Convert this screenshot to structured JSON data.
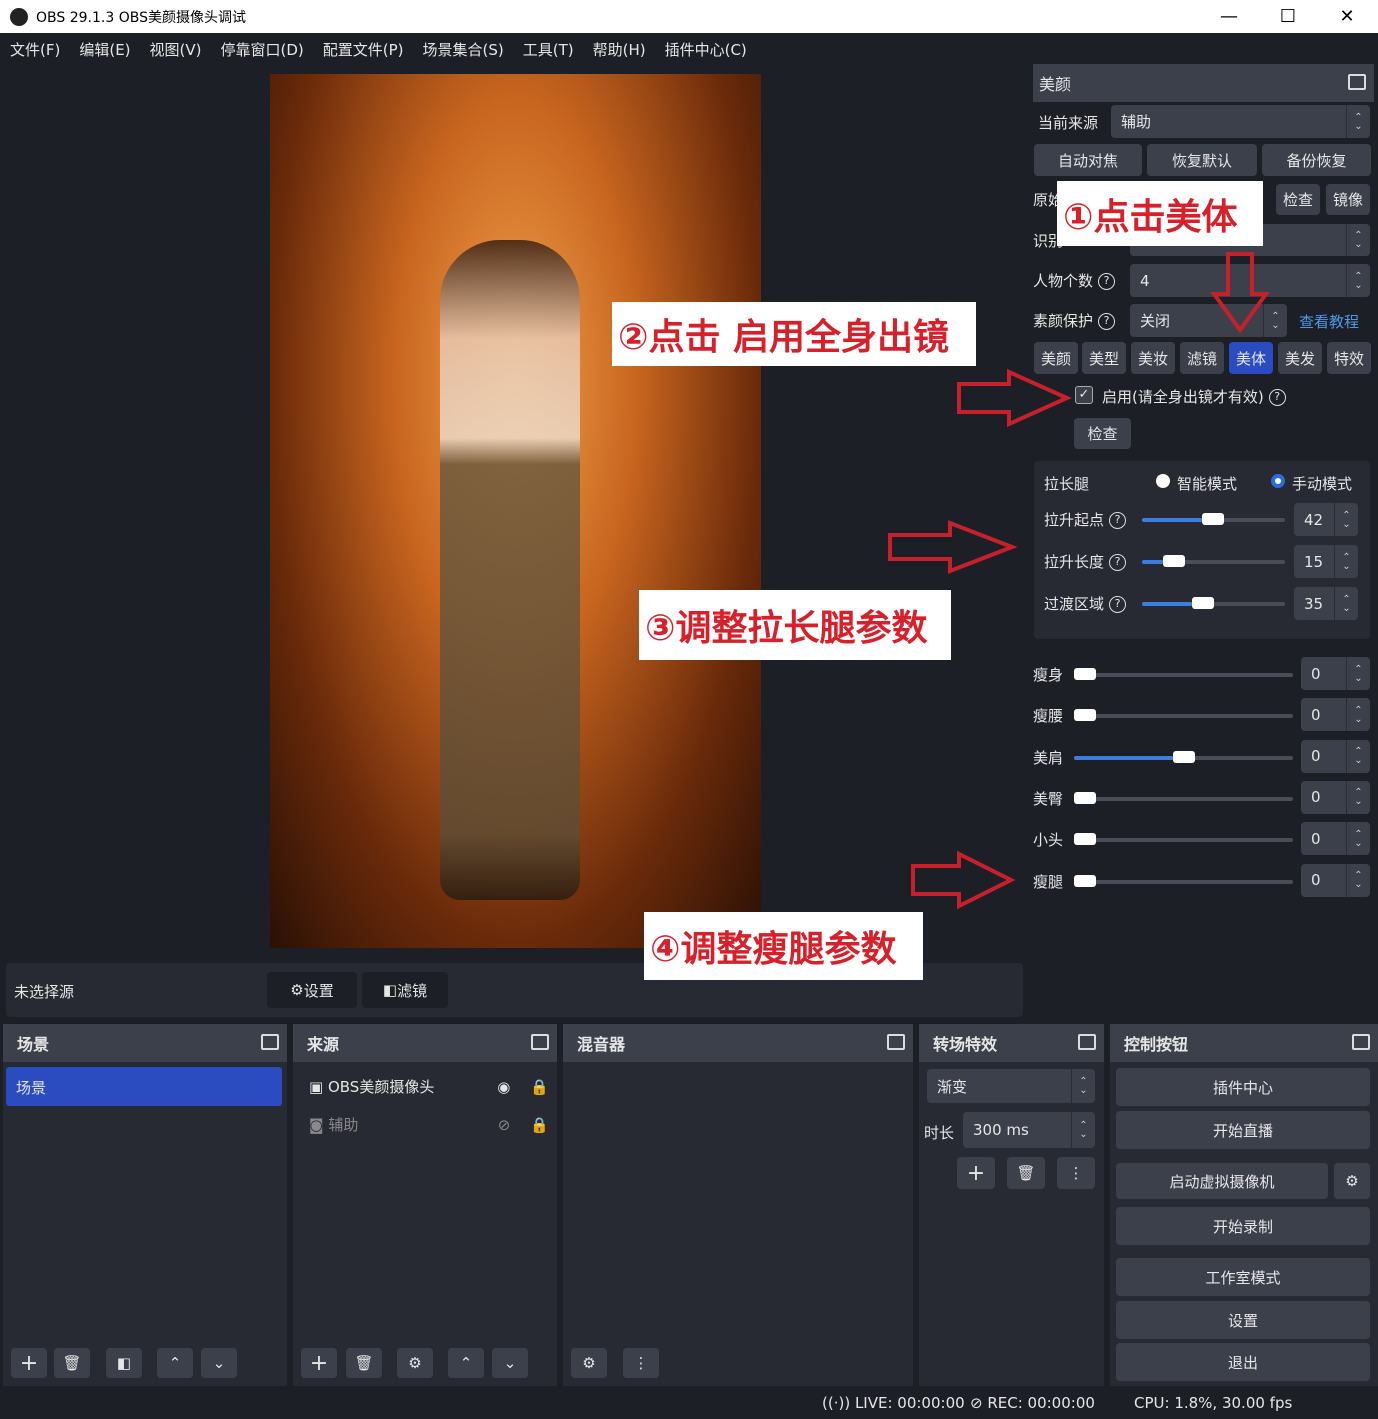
{
  "titlebar": {
    "title": "OBS 29.1.3  OBS美颜摄像头调试",
    "minimize": "—",
    "maximize": "☐",
    "close": "✕"
  },
  "menu": [
    "文件(F)",
    "编辑(E)",
    "视图(V)",
    "停靠窗口(D)",
    "配置文件(P)",
    "场景集合(S)",
    "工具(T)",
    "帮助(H)",
    "插件中心(C)"
  ],
  "beauty": {
    "title": "美颜",
    "current_source_label": "当前来源",
    "current_source": "辅助",
    "buttons": [
      "自动对焦",
      "恢复默认",
      "备份恢复"
    ],
    "original_label": "原始",
    "check": "检查",
    "mirror": "镜像",
    "recog_label": "识别",
    "person_count_label": "人物个数",
    "person_count": "4",
    "protect_label": "素颜保护",
    "protect_value": "关闭",
    "tutorial": "查看教程",
    "tabs": [
      "美颜",
      "美型",
      "美妆",
      "滤镜",
      "美体",
      "美发",
      "特效"
    ],
    "active_tab": "美体",
    "enable_label": "启用(请全身出镜才有效)",
    "enable_checked": true,
    "check2": "检查",
    "leg": {
      "label": "拉长腿",
      "mode_smart": "智能模式",
      "mode_manual": "手动模式",
      "selected_mode": "手动模式",
      "params": [
        {
          "label": "拉升起点",
          "value": "42"
        },
        {
          "label": "拉升长度",
          "value": "15"
        },
        {
          "label": "过渡区域",
          "value": "35"
        }
      ]
    },
    "sliders": [
      {
        "label": "瘦身",
        "value": "0"
      },
      {
        "label": "瘦腰",
        "value": "0"
      },
      {
        "label": "美肩",
        "value": "0"
      },
      {
        "label": "美臀",
        "value": "0"
      },
      {
        "label": "小头",
        "value": "0"
      },
      {
        "label": "瘦腿",
        "value": "0"
      }
    ]
  },
  "annotations": [
    "①点击美体",
    "②点击 启用全身出镜",
    "③调整拉长腿参数",
    "④调整瘦腿参数"
  ],
  "sourcebar": {
    "no_source": "未选择源",
    "settings": "设置",
    "filters": "滤镜"
  },
  "scenes": {
    "title": "场景",
    "items": [
      "场景"
    ]
  },
  "sources": {
    "title": "来源",
    "items": [
      {
        "name": "OBS美颜摄像头",
        "visible": true
      },
      {
        "name": "辅助",
        "visible": false
      }
    ]
  },
  "mixer": {
    "title": "混音器"
  },
  "transitions": {
    "title": "转场特效",
    "type": "渐变",
    "duration_label": "时长",
    "duration": "300 ms"
  },
  "controls": {
    "title": "控制按钮",
    "buttons": [
      "插件中心",
      "开始直播",
      "启动虚拟摄像机",
      "开始录制",
      "工作室模式",
      "设置",
      "退出"
    ]
  },
  "status": {
    "live": "LIVE: 00:00:00",
    "rec": "REC: 00:00:00",
    "cpu": "CPU: 1.8%, 30.00 fps"
  },
  "colors": {
    "accent": "#2b4cc0",
    "annotation": "#d8202a",
    "link": "#4a9ae8"
  }
}
